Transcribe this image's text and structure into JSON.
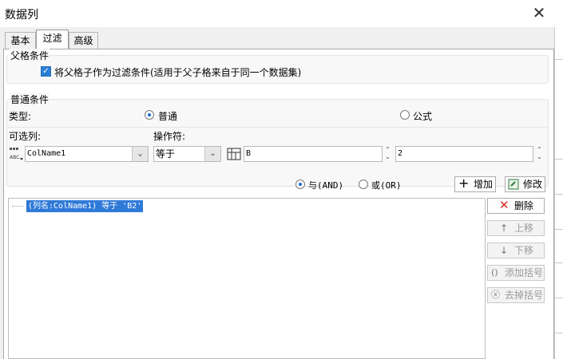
{
  "window": {
    "title": "数据列",
    "close_glyph": "✕"
  },
  "tabs": [
    {
      "label": "基本",
      "active": false
    },
    {
      "label": "过滤",
      "active": true
    },
    {
      "label": "高级",
      "active": false
    }
  ],
  "parent_condition": {
    "group_label": "父格条件",
    "checkbox_label": "将父格子作为过滤条件(适用于父子格来自于同一个数据集)",
    "checked": true
  },
  "normal_condition": {
    "group_label": "普通条件",
    "type_label": "类型:",
    "type_options": [
      {
        "label": "普通",
        "selected": true
      },
      {
        "label": "公式",
        "selected": false
      }
    ],
    "column_label": "可选列:",
    "operator_label": "操作符:",
    "column_value": "ColName1",
    "operator_value": "等于",
    "value_text": "B",
    "value_text_2": "2"
  },
  "logic": {
    "and_label": "与(AND)",
    "or_label": "或(OR)",
    "selected": "and"
  },
  "buttons": {
    "add": "增加",
    "modify": "修改",
    "delete": "删除",
    "up": "上移",
    "down": "下移",
    "add_bracket": "添加括号",
    "remove_bracket": "去掉括号"
  },
  "conditions": [
    {
      "text": "(列名:ColName1) 等于 'B2'",
      "selected": true
    }
  ],
  "colors": {
    "selection": "#2f7ad8",
    "checkbox": "#2a7fd4",
    "delete_icon": "#d62a2a"
  }
}
